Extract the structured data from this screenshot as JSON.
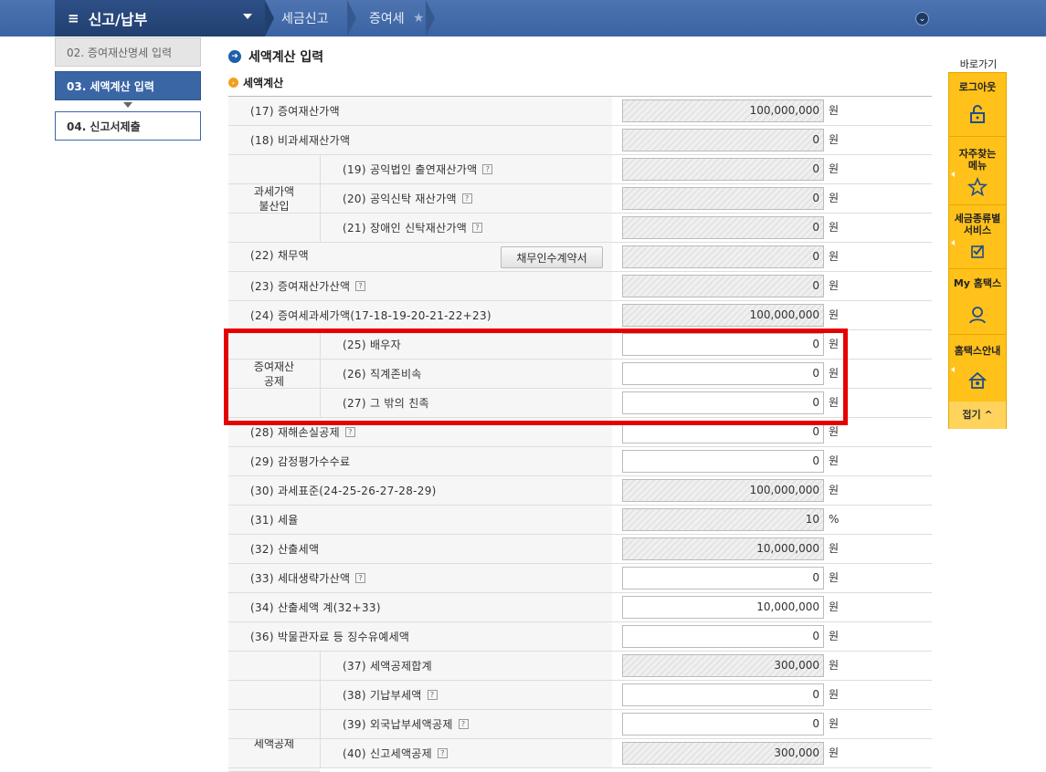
{
  "menu": {
    "title": "신고/납부"
  },
  "breadcrumb": {
    "level1": "세금신고",
    "level2": "증여세"
  },
  "steps": {
    "s02": "02. 증여재산명세 입력",
    "s03": "03. 세액계산 입력",
    "s04": "04. 신고서제출"
  },
  "headings": {
    "main": "세액계산 입력",
    "sub": "세액계산"
  },
  "groups": {
    "nontax": "과세가액\n불산입",
    "deduct": "증여재산\n공제",
    "credit": "세액공제"
  },
  "debt_button": "채무인수계약서",
  "rows": [
    {
      "label": "(17) 증여재산가액",
      "value": "100,000,000",
      "unit": "원"
    },
    {
      "label": "(18) 비과세재산가액",
      "value": "0",
      "unit": "원"
    },
    {
      "label": "(19) 공익법인 출연재산가액",
      "value": "0",
      "unit": "원"
    },
    {
      "label": "(20) 공익신탁 재산가액",
      "value": "0",
      "unit": "원"
    },
    {
      "label": "(21) 장애인 신탁재산가액",
      "value": "0",
      "unit": "원"
    },
    {
      "label": "(22) 채무액",
      "value": "0",
      "unit": "원"
    },
    {
      "label": "(23) 증여재산가산액",
      "value": "0",
      "unit": "원"
    },
    {
      "label": "(24) 증여세과세가액(17-18-19-20-21-22+23)",
      "value": "100,000,000",
      "unit": "원"
    },
    {
      "label": "(25) 배우자",
      "value": "0",
      "unit": "원"
    },
    {
      "label": "(26) 직계존비속",
      "value": "0",
      "unit": "원"
    },
    {
      "label": "(27) 그 밖의 친족",
      "value": "0",
      "unit": "원"
    },
    {
      "label": "(28) 재해손실공제",
      "value": "0",
      "unit": "원"
    },
    {
      "label": "(29) 감정평가수수료",
      "value": "0",
      "unit": "원"
    },
    {
      "label": "(30) 과세표준(24-25-26-27-28-29)",
      "value": "100,000,000",
      "unit": "원"
    },
    {
      "label": "(31) 세율",
      "value": "10",
      "unit": "%"
    },
    {
      "label": "(32) 산출세액",
      "value": "10,000,000",
      "unit": "원"
    },
    {
      "label": "(33) 세대생략가산액",
      "value": "0",
      "unit": "원"
    },
    {
      "label": "(34) 산출세액 계(32+33)",
      "value": "10,000,000",
      "unit": "원"
    },
    {
      "label": "(36) 박물관자료 등 징수유예세액",
      "value": "0",
      "unit": "원"
    },
    {
      "label": "(37) 세액공제합계",
      "value": "300,000",
      "unit": "원"
    },
    {
      "label": "(38) 기납부세액",
      "value": "0",
      "unit": "원"
    },
    {
      "label": "(39) 외국납부세액공제",
      "value": "0",
      "unit": "원"
    },
    {
      "label": "(40) 신고세액공제",
      "value": "300,000",
      "unit": "원"
    }
  ],
  "quick": {
    "title": "바로가기",
    "logout": "로그아웃",
    "faq": "자주찾는\n메뉴",
    "taxsvc": "세금종류별\n서비스",
    "my": "My 홈택스",
    "guide": "홈택스안내",
    "close": "접기 ^"
  }
}
